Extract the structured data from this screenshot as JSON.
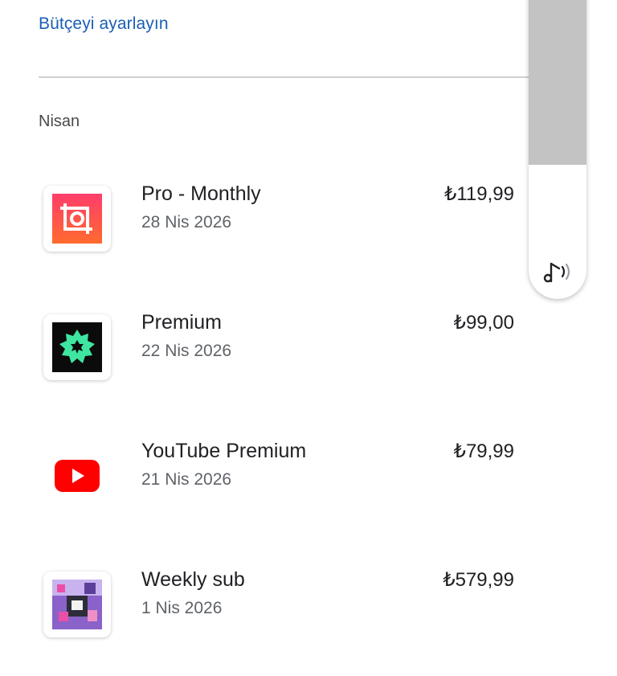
{
  "budget_link": "Bütçeyi ayarlayın",
  "month": "Nisan",
  "items": [
    {
      "title": "Pro - Monthly",
      "date": "28 Nis 2026",
      "price": "₺119,99",
      "icon": "inshot-app-icon"
    },
    {
      "title": "Premium",
      "date": "22 Nis 2026",
      "price": "₺99,00",
      "icon": "star-badge-app-icon"
    },
    {
      "title": "YouTube Premium",
      "date": "21 Nis 2026",
      "price": "₺79,99",
      "icon": "youtube-icon"
    },
    {
      "title": "Weekly sub",
      "date": "1 Nis 2026",
      "price": "₺579,99",
      "icon": "game-app-icon"
    }
  ],
  "volume_level_percent": 60,
  "colors": {
    "link": "#1a5fb4",
    "youtube_red": "#ff0000",
    "premium_green": "#3ee6a0"
  }
}
